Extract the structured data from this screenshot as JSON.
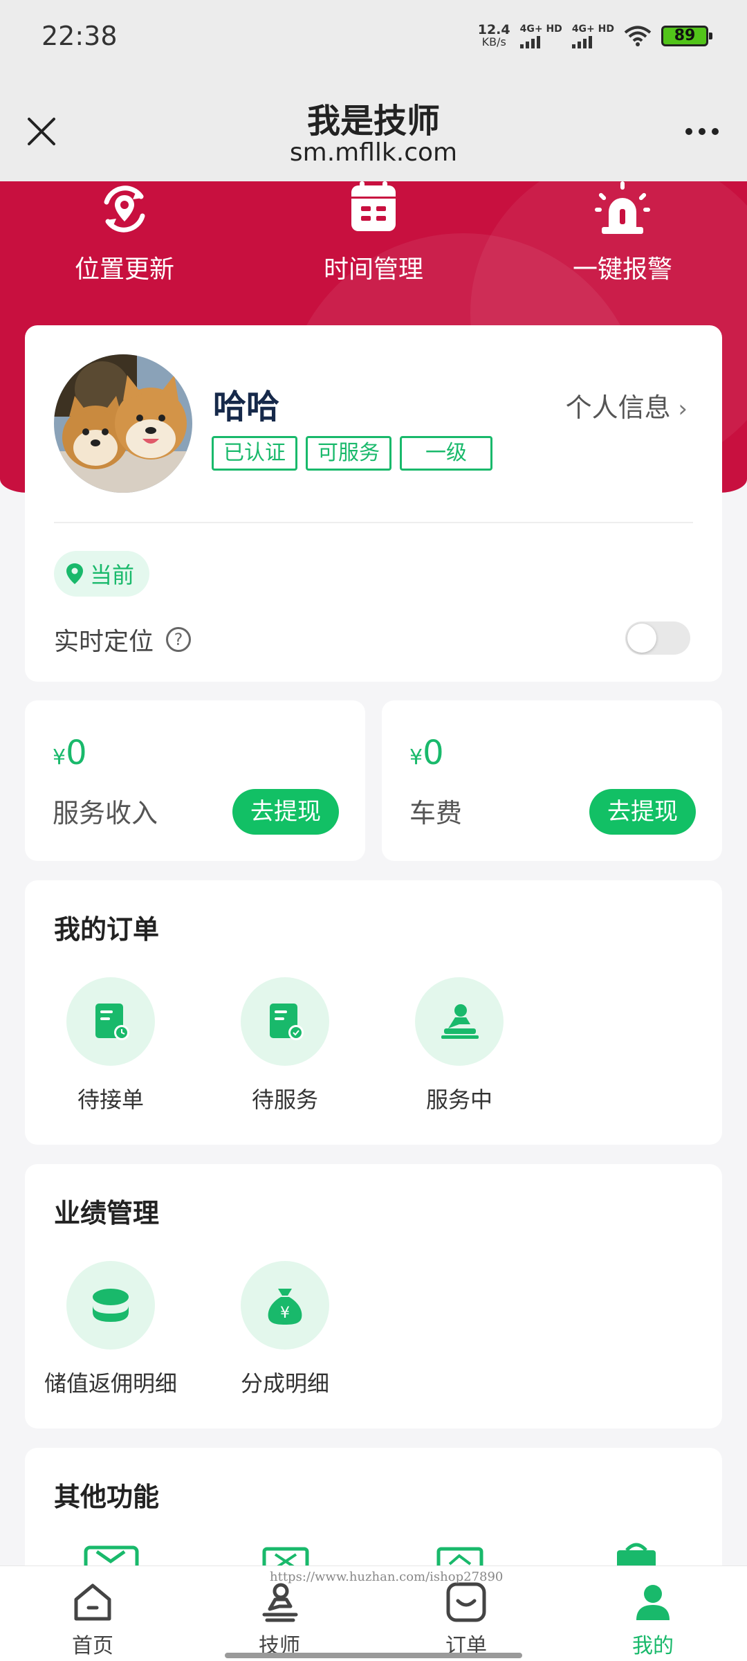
{
  "status_bar": {
    "time": "22:38",
    "net_speed_value": "12.4",
    "net_speed_unit": "KB/s",
    "sim1": "4G+ HD",
    "sim2": "4G+ HD",
    "battery": "89"
  },
  "title_bar": {
    "title": "我是技师",
    "subtitle": "sm.mfllk.com"
  },
  "hero_actions": [
    {
      "label": "位置更新",
      "icon": "location-refresh-icon"
    },
    {
      "label": "时间管理",
      "icon": "calendar-icon"
    },
    {
      "label": "一键报警",
      "icon": "alarm-light-icon"
    }
  ],
  "profile": {
    "name": "哈哈",
    "link_label": "个人信息",
    "tags": [
      "已认证",
      "可服务",
      "一级"
    ],
    "location_pill": "当前",
    "realtime_location_label": "实时定位",
    "realtime_location_on": false
  },
  "money": [
    {
      "currency": "¥",
      "amount": "0",
      "label": "服务收入",
      "button": "去提现"
    },
    {
      "currency": "¥",
      "amount": "0",
      "label": "车费",
      "button": "去提现"
    }
  ],
  "orders": {
    "title": "我的订单",
    "items": [
      {
        "label": "待接单",
        "icon": "pending-order-icon"
      },
      {
        "label": "待服务",
        "icon": "to-serve-icon"
      },
      {
        "label": "服务中",
        "icon": "in-service-icon"
      }
    ]
  },
  "performance": {
    "title": "业绩管理",
    "items": [
      {
        "label": "储值返佣明细",
        "icon": "coin-stack-icon"
      },
      {
        "label": "分成明细",
        "icon": "money-bag-icon"
      }
    ]
  },
  "other": {
    "title": "其他功能"
  },
  "bottom_nav": [
    {
      "label": "首页",
      "icon": "home-icon",
      "active": false
    },
    {
      "label": "技师",
      "icon": "technician-icon",
      "active": false
    },
    {
      "label": "订单",
      "icon": "order-icon",
      "active": false
    },
    {
      "label": "我的",
      "icon": "user-icon",
      "active": true
    }
  ],
  "watermark": "https://www.huzhan.com/ishop27890",
  "colors": {
    "brand_red": "#c8103f",
    "accent_green": "#19b96b",
    "button_green": "#12c065"
  }
}
